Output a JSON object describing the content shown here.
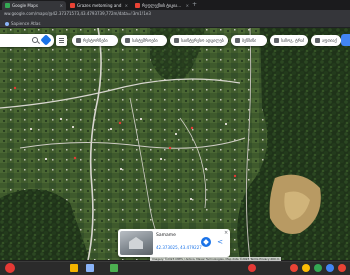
{
  "browser": {
    "tabs": [
      {
        "title": "Google Maps",
        "active": true,
        "favicon_color": "#34a853"
      },
      {
        "title": "Grazes metoming and prcy...",
        "active": false,
        "favicon_color": "#ea4335"
      },
      {
        "title": "რეფლექსის ტიკია...",
        "active": false,
        "favicon_color": "#ea4335"
      }
    ],
    "close_glyph": "×",
    "new_tab_glyph": "+",
    "url": "ww.google.com/maps/@42.37371573,43.4793739,772m/data=!3m1!1e3",
    "bookmarks": [
      {
        "label": "Sapience Atlas",
        "icon": "bookmark-icon"
      }
    ]
  },
  "maps": {
    "menu_icon": "hamburger-icon",
    "search_icon": "search-icon",
    "directions_icon": "directions-icon",
    "chips": [
      {
        "label": "რესტორნები",
        "icon": "restaurant-icon"
      },
      {
        "label": "სასტუმროები",
        "icon": "hotel-icon"
      },
      {
        "label": "საინტერესო ადგილები",
        "icon": "camera-icon"
      },
      {
        "label": "ბენზინი",
        "icon": "gas-icon"
      },
      {
        "label": "საზოგ. ტრანსპ.",
        "icon": "transit-icon"
      },
      {
        "label": "აფთიაქი",
        "icon": "pharmacy-icon"
      }
    ],
    "place_card": {
      "name": "Samame",
      "coordinates": "42.373025, 43.479227",
      "close_glyph": "×",
      "share_glyph": "<"
    },
    "attribution": "Imagery ©2023 CNES / Airbus, Maxar Technologies, Map data ©2023   Terms   Privacy   200 m"
  },
  "colors": {
    "accent": "#1a73e8",
    "map_road": "#e8e8e8"
  }
}
